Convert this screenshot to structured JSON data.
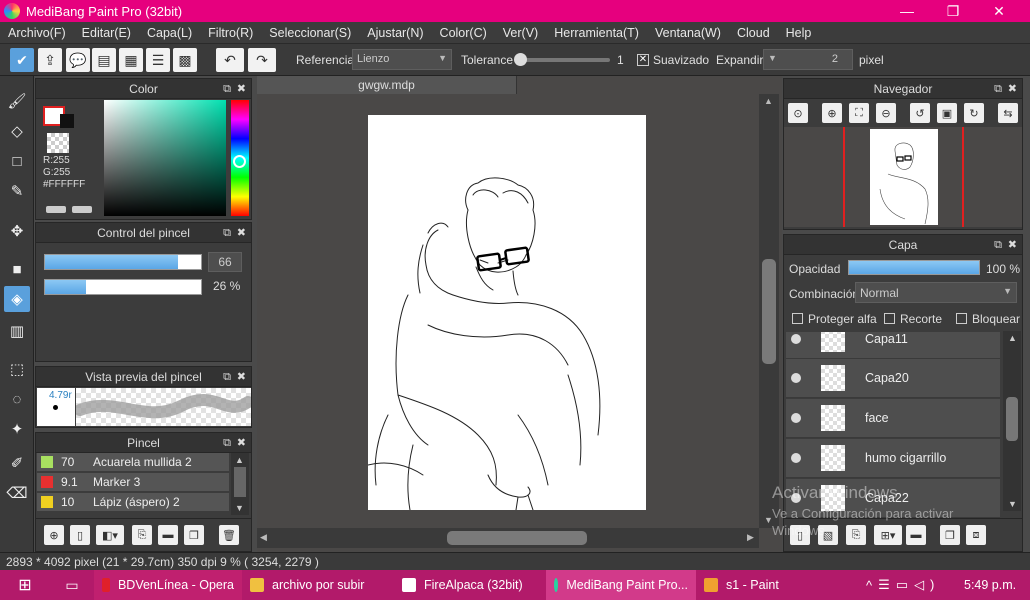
{
  "window": {
    "title": "MediBang Paint Pro (32bit)",
    "minimize": "—",
    "maximize": "❐",
    "close": "✕"
  },
  "menu": [
    "Archivo(F)",
    "Editar(E)",
    "Capa(L)",
    "Filtro(R)",
    "Seleccionar(S)",
    "Ajustar(N)",
    "Color(C)",
    "Ver(V)",
    "Herramienta(T)",
    "Ventana(W)",
    "Cloud",
    "Help"
  ],
  "toolbar": {
    "referencia_label": "Referencia",
    "referencia_value": "Lienzo",
    "tolerance_label": "Tolerance",
    "tolerance_value": "1",
    "suavizado_label": "Suavizado",
    "expandir_label": "Expandir",
    "expandir_value": "2",
    "expandir_unit": "pixel"
  },
  "color_panel": {
    "title": "Color",
    "r": "R:255",
    "g": "G:255",
    "hex": "#FFFFFF",
    "primary_color": "#ffffff",
    "hue_color": "#00e0b0"
  },
  "brush_control": {
    "title": "Control del pincel",
    "size": "66",
    "size_fraction": 0.85,
    "opacity": "26 %",
    "opacity_fraction": 0.26
  },
  "brush_preview": {
    "title": "Vista previa del pincel",
    "size": "4.79r"
  },
  "brush_list": {
    "title": "Pincel",
    "items": [
      {
        "size": "70",
        "name": "Acuarela mullida 2",
        "color": "#a8e060"
      },
      {
        "size": "9.1",
        "name": "Marker 3",
        "color": "#e83030"
      },
      {
        "size": "10",
        "name": "Lápiz (áspero) 2",
        "color": "#f0d020"
      }
    ]
  },
  "document": {
    "tab": "gwgw.mdp"
  },
  "navigator": {
    "title": "Navegador"
  },
  "layer_panel": {
    "title": "Capa",
    "opacity_label": "Opacidad",
    "opacity_value": "100 %",
    "opacity_fraction": 1.0,
    "blend_label": "Combinación",
    "blend_value": "Normal",
    "protect_alpha": "Proteger alfa",
    "clipping": "Recorte",
    "lock": "Bloquear",
    "layers": [
      "Capa11",
      "Capa20",
      "face",
      "humo cigarrillo",
      "Capa22"
    ]
  },
  "watermark": {
    "line1": "Activar Windows",
    "line2": "Ve a Configuración para activar",
    "line3": "Windows."
  },
  "status": {
    "text": "2893 * 4092 pixel   (21 * 29.7cm)   350 dpi   9 %   ( 3254, 2279 )"
  },
  "taskbar": {
    "items": [
      {
        "label": "BDVenLínea - Opera",
        "color": "#e0202a"
      },
      {
        "label": "archivo por subir",
        "color": "#f0c040"
      },
      {
        "label": "FireAlpaca (32bit)",
        "color": "#ffffff"
      },
      {
        "label": "MediBang Paint Pro...",
        "color": "#2ad0a0"
      },
      {
        "label": "s1 - Paint",
        "color": "#f0a030"
      }
    ],
    "time": "5:49 p.m."
  }
}
